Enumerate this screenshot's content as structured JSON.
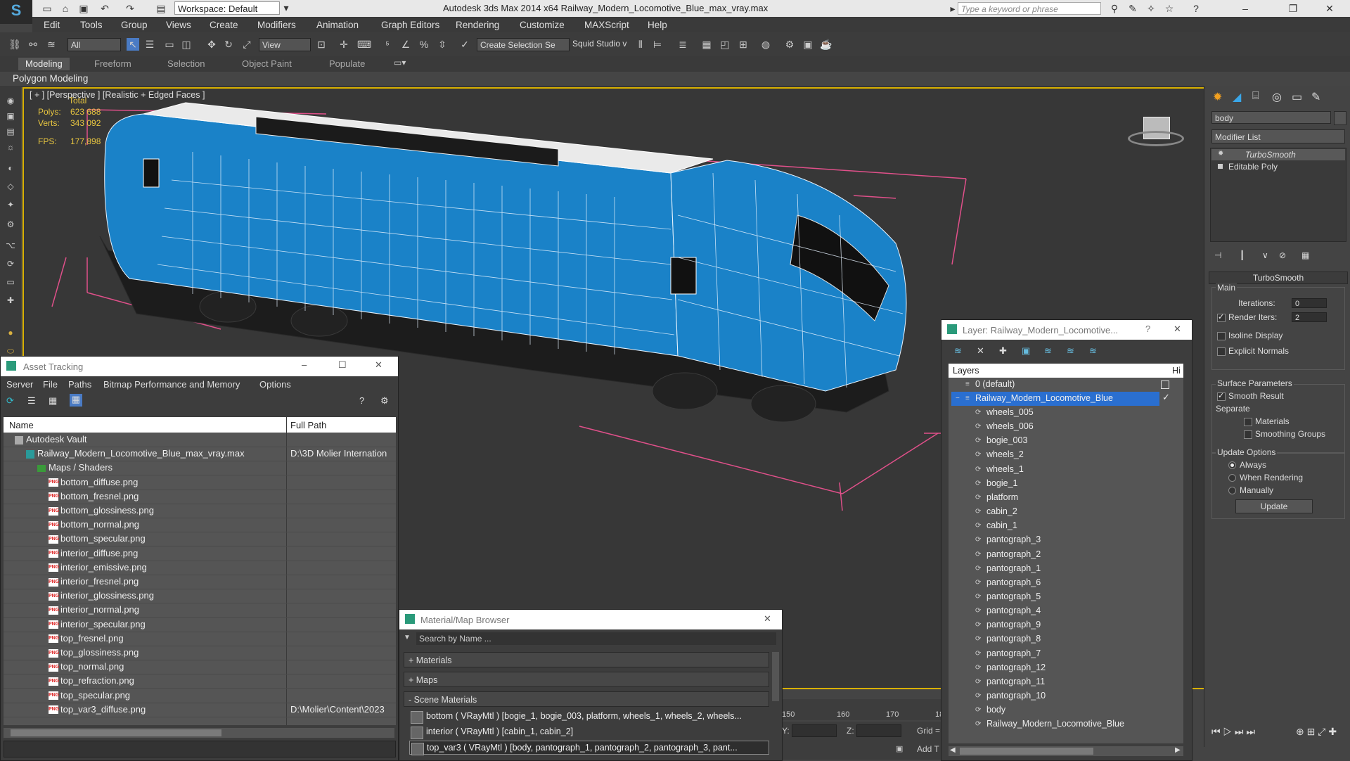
{
  "app": {
    "window_title": "Autodesk 3ds Max  2014 x64     Railway_Modern_Locomotive_Blue_max_vray.max",
    "workspace_label": "Workspace: Default",
    "search_placeholder": "Type a keyword or phrase"
  },
  "menu": [
    "Edit",
    "Tools",
    "Group",
    "Views",
    "Create",
    "Modifiers",
    "Animation",
    "Graph Editors",
    "Rendering",
    "Customize",
    "MAXScript",
    "Help"
  ],
  "toolbar": {
    "selection_filter": "All",
    "ref_coord": "View",
    "named_selection": "Create Selection Se",
    "studio_label": "Squid Studio v"
  },
  "ribbon": {
    "tabs": [
      "Modeling",
      "Freeform",
      "Selection",
      "Object Paint",
      "Populate"
    ],
    "active_tab": "Modeling",
    "panel_label": "Polygon Modeling"
  },
  "viewport": {
    "label": "[ + ] [Perspective ] [Realistic + Edged Faces ]",
    "stats": {
      "total_label": "Total",
      "polys_label": "Polys:",
      "polys_value": "623 688",
      "verts_label": "Verts:",
      "verts_value": "343 092",
      "fps_label": "FPS:",
      "fps_value": "177,898"
    },
    "timeline_ticks": [
      "150",
      "160",
      "170",
      "18"
    ],
    "y_label": "Y:",
    "z_label": "Z:",
    "grid_label": "Grid =",
    "addt_label": "Add T"
  },
  "command_panel": {
    "object_name": "body",
    "modifier_list_label": "Modifier List",
    "stack": [
      "TurboSmooth",
      "Editable Poly"
    ],
    "rollout_title": "TurboSmooth",
    "main_label": "Main",
    "iterations_label": "Iterations:",
    "iterations_value": "0",
    "render_iters_label": "Render Iters:",
    "render_iters_value": "2",
    "render_iters_checked": true,
    "isoline_label": "Isoline Display",
    "explicit_label": "Explicit Normals",
    "surface_label": "Surface Parameters",
    "smooth_result_label": "Smooth Result",
    "separate_label": "Separate",
    "materials_label": "Materials",
    "smoothing_groups_label": "Smoothing Groups",
    "update_options_label": "Update Options",
    "always_label": "Always",
    "when_rendering_label": "When Rendering",
    "manually_label": "Manually",
    "update_button": "Update"
  },
  "asset_tracking": {
    "title": "Asset Tracking",
    "menu": [
      "Server",
      "File",
      "Paths",
      "Bitmap Performance and Memory",
      "Options"
    ],
    "col_name": "Name",
    "col_path": "Full Path",
    "rows": [
      {
        "name": "Autodesk Vault",
        "path": "",
        "indent": 0,
        "kind": "vault"
      },
      {
        "name": "Railway_Modern_Locomotive_Blue_max_vray.max",
        "path": "D:\\3D Molier Internation",
        "indent": 1,
        "kind": "max"
      },
      {
        "name": "Maps / Shaders",
        "path": "",
        "indent": 2,
        "kind": "folder"
      },
      {
        "name": "bottom_diffuse.png",
        "path": "",
        "indent": 3,
        "kind": "png"
      },
      {
        "name": "bottom_fresnel.png",
        "path": "",
        "indent": 3,
        "kind": "png"
      },
      {
        "name": "bottom_glossiness.png",
        "path": "",
        "indent": 3,
        "kind": "png"
      },
      {
        "name": "bottom_normal.png",
        "path": "",
        "indent": 3,
        "kind": "png"
      },
      {
        "name": "bottom_specular.png",
        "path": "",
        "indent": 3,
        "kind": "png"
      },
      {
        "name": "interior_diffuse.png",
        "path": "",
        "indent": 3,
        "kind": "png"
      },
      {
        "name": "interior_emissive.png",
        "path": "",
        "indent": 3,
        "kind": "png"
      },
      {
        "name": "interior_fresnel.png",
        "path": "",
        "indent": 3,
        "kind": "png"
      },
      {
        "name": "interior_glossiness.png",
        "path": "",
        "indent": 3,
        "kind": "png"
      },
      {
        "name": "interior_normal.png",
        "path": "",
        "indent": 3,
        "kind": "png"
      },
      {
        "name": "interior_specular.png",
        "path": "",
        "indent": 3,
        "kind": "png"
      },
      {
        "name": "top_fresnel.png",
        "path": "",
        "indent": 3,
        "kind": "png"
      },
      {
        "name": "top_glossiness.png",
        "path": "",
        "indent": 3,
        "kind": "png"
      },
      {
        "name": "top_normal.png",
        "path": "",
        "indent": 3,
        "kind": "png"
      },
      {
        "name": "top_refraction.png",
        "path": "",
        "indent": 3,
        "kind": "png"
      },
      {
        "name": "top_specular.png",
        "path": "",
        "indent": 3,
        "kind": "png"
      },
      {
        "name": "top_var3_diffuse.png",
        "path": "D:\\Molier\\Content\\2023",
        "indent": 3,
        "kind": "png"
      }
    ]
  },
  "material_browser": {
    "title": "Material/Map Browser",
    "search_placeholder": "Search by Name ...",
    "sections": [
      "+ Materials",
      "+ Maps",
      "- Scene Materials"
    ],
    "scene_materials": [
      "bottom  ( VRayMtl ) [bogie_1, bogie_003, platform, wheels_1, wheels_2, wheels...",
      "interior  ( VRayMtl ) [cabin_1, cabin_2]",
      "top_var3  ( VRayMtl ) [body, pantograph_1, pantograph_2, pantograph_3, pant..."
    ]
  },
  "layer_explorer": {
    "title": "Layer: Railway_Modern_Locomotive...",
    "col_layers": "Layers",
    "col_hide": "Hi",
    "default_layer": "0 (default)",
    "active_layer": "Railway_Modern_Locomotive_Blue",
    "objects": [
      "wheels_005",
      "wheels_006",
      "bogie_003",
      "wheels_2",
      "wheels_1",
      "bogie_1",
      "platform",
      "cabin_2",
      "cabin_1",
      "pantograph_3",
      "pantograph_2",
      "pantograph_1",
      "pantograph_6",
      "pantograph_5",
      "pantograph_4",
      "pantograph_9",
      "pantograph_8",
      "pantograph_7",
      "pantograph_12",
      "pantograph_11",
      "pantograph_10",
      "body",
      "Railway_Modern_Locomotive_Blue"
    ]
  },
  "colors": {
    "viewport_border": "#d8b000",
    "locomotive_blue": "#1a82c8",
    "selection_bbox": "#e0508a",
    "stats_text": "#e8c640",
    "layer_selected": "#2a6fd0"
  }
}
